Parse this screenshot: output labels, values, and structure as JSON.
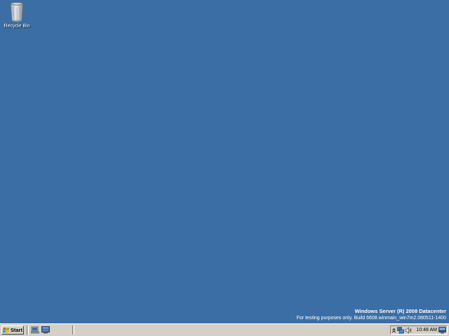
{
  "desktop": {
    "background_color": "#3b6ea5",
    "icons": [
      {
        "label": "Recycle Bin",
        "icon": "recycle-bin-icon"
      }
    ],
    "watermark": {
      "line1": "Windows Server (R) 2008 Datacenter",
      "line2": "For testing purposes only. Build 6608.winmain_win7m2.080511-1400"
    }
  },
  "taskbar": {
    "start_label": "Start",
    "quick_launch": [
      {
        "icon": "show-desktop-icon"
      },
      {
        "icon": "server-manager-icon"
      }
    ],
    "tray": {
      "icons": [
        "show-hidden-icons-chevron",
        "network-icon",
        "volume-icon",
        "show-desktop-tray-icon"
      ],
      "clock": "10:48 AM"
    }
  }
}
